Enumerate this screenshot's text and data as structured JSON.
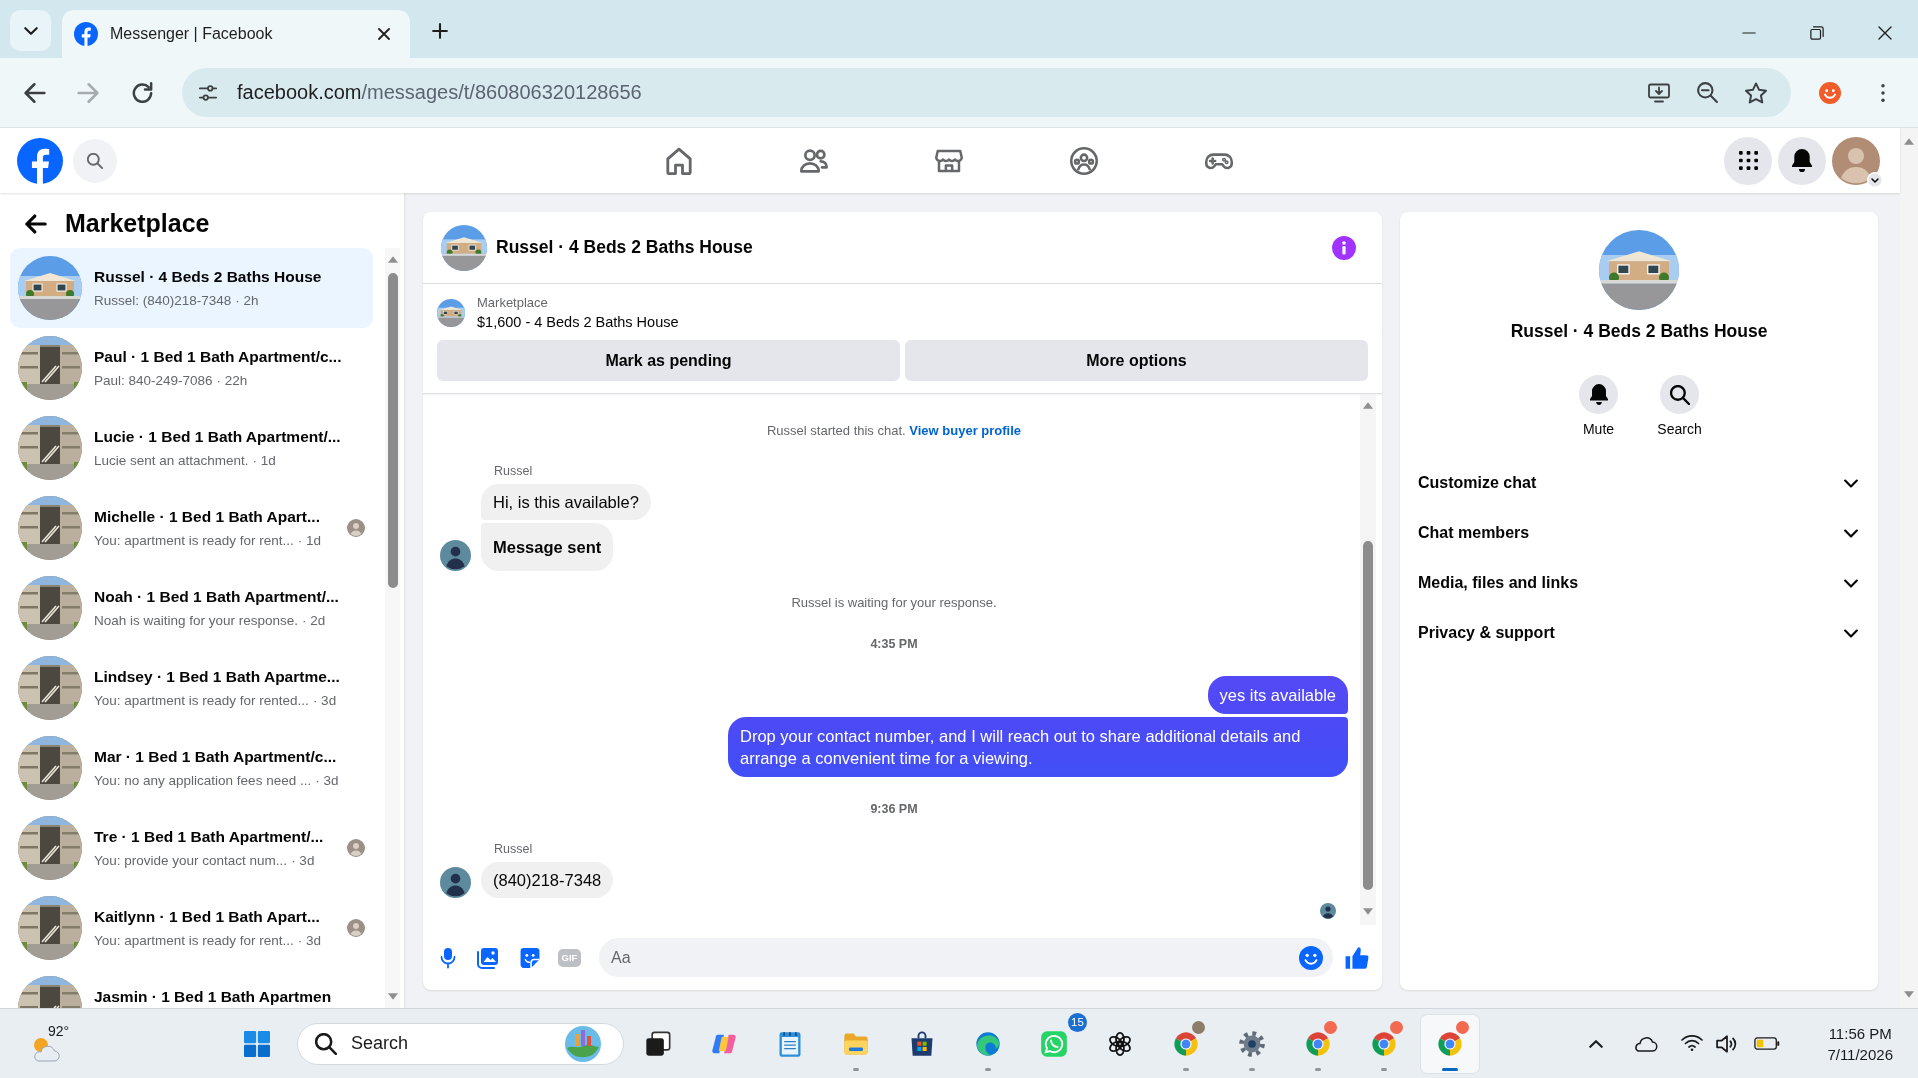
{
  "browser": {
    "tabs": [
      {
        "title": "Messenger | Facebook",
        "selected": true
      }
    ],
    "address": {
      "host": "facebook.com",
      "path": "/messages/t/860806320128656"
    }
  },
  "header": {
    "nav": [
      {
        "kind": "home"
      },
      {
        "kind": "friends"
      },
      {
        "kind": "marketplace"
      },
      {
        "kind": "groups"
      },
      {
        "kind": "gaming"
      }
    ]
  },
  "sidebar": {
    "title": "Marketplace",
    "conversations": [
      {
        "kind": "house",
        "title": "Russel · 4 Beds 2 Baths House",
        "preview": "Russel: (840)218-7348",
        "time": "· 2h",
        "seen": false,
        "selected": true
      },
      {
        "kind": "apartment",
        "title": "Paul · 1 Bed 1 Bath Apartment/c...",
        "preview": "Paul: 840-249-7086",
        "time": "· 22h",
        "seen": false,
        "selected": false
      },
      {
        "kind": "apartment",
        "title": "Lucie · 1 Bed 1 Bath Apartment/...",
        "preview": "Lucie sent an attachment.",
        "time": "· 1d",
        "seen": false,
        "selected": false
      },
      {
        "kind": "apartment",
        "title": "Michelle · 1 Bed 1 Bath Apart...",
        "preview": "You: apartment is ready for rent...",
        "time": "· 1d",
        "seen": true,
        "selected": false
      },
      {
        "kind": "apartment",
        "title": "Noah · 1 Bed 1 Bath Apartment/...",
        "preview": "Noah is waiting for your response.",
        "time": "· 2d",
        "seen": false,
        "selected": false
      },
      {
        "kind": "apartment",
        "title": "Lindsey · 1 Bed 1 Bath Apartme...",
        "preview": "You: apartment is ready for rented...",
        "time": "· 3d",
        "seen": false,
        "selected": false
      },
      {
        "kind": "apartment",
        "title": "Mar · 1 Bed 1 Bath Apartment/c...",
        "preview": "You: no any application fees need ...",
        "time": "· 3d",
        "seen": false,
        "selected": false
      },
      {
        "kind": "apartment",
        "title": "Tre · 1 Bed 1 Bath Apartment/...",
        "preview": "You: provide your contact num...",
        "time": "· 3d",
        "seen": true,
        "selected": false
      },
      {
        "kind": "apartment",
        "title": "Kaitlynn · 1 Bed 1 Bath Apart...",
        "preview": "You: apartment is ready for rent...",
        "time": "· 3d",
        "seen": true,
        "selected": false
      },
      {
        "kind": "apartment",
        "title": "Jasmin · 1 Bed 1 Bath Apartmen",
        "seen": false,
        "selected": false
      }
    ]
  },
  "chat": {
    "title": "Russel · 4 Beds 2 Baths House",
    "listing": {
      "source": "Marketplace",
      "title": "$1,600 - 4 Beds 2 Baths House"
    },
    "actions": [
      "Mark as pending",
      "More options"
    ],
    "messages": [
      {
        "kind": "notice",
        "text": "Russel started this chat.",
        "link": "View buyer profile"
      },
      {
        "kind": "incoming",
        "sender": "Russel",
        "bubbles": [
          {
            "text": "Hi, is this available?",
            "bold": false
          },
          {
            "text": "Message sent",
            "bold": true
          }
        ]
      },
      {
        "kind": "notice",
        "text": "Russel is waiting for your response."
      },
      {
        "kind": "timestamp",
        "text": "4:35 PM"
      },
      {
        "kind": "outgoing",
        "bubbles": [
          {
            "text": "yes its available"
          },
          {
            "text": "Drop your contact number, and I will reach out to share additional details and arrange a convenient time for a viewing."
          }
        ]
      },
      {
        "kind": "timestamp",
        "text": "9:36 PM"
      },
      {
        "kind": "incoming",
        "sender": "Russel",
        "bubbles": [
          {
            "text": "(840)218-7348",
            "bold": false
          }
        ]
      }
    ],
    "seen": true,
    "composer": {
      "gif_label": "GIF",
      "placeholder": "Aa"
    }
  },
  "details": {
    "title": "Russel · 4 Beds 2 Baths House",
    "actions": [
      {
        "kind": "mute",
        "label": "Mute"
      },
      {
        "kind": "search",
        "label": "Search"
      }
    ],
    "sections": [
      {
        "label": "Customize chat",
        "expanded": false
      },
      {
        "label": "Chat members",
        "expanded": false
      },
      {
        "label": "Media, files and links",
        "expanded": false
      },
      {
        "label": "Privacy & support",
        "expanded": false
      }
    ]
  },
  "taskbar": {
    "weather": {
      "temp": "92°"
    },
    "search": {
      "label": "Search"
    },
    "apps": [
      {
        "kind": "task-view",
        "running": false,
        "selected": false
      },
      {
        "kind": "copilot",
        "running": false,
        "selected": false
      },
      {
        "kind": "notepad",
        "running": false,
        "selected": false
      },
      {
        "kind": "files",
        "running": true,
        "selected": false
      },
      {
        "kind": "store",
        "running": false,
        "selected": false
      },
      {
        "kind": "edge",
        "running": true,
        "selected": false
      },
      {
        "kind": "whatsapp",
        "running": false,
        "selected": false,
        "badge": "15"
      },
      {
        "kind": "chatgpt",
        "running": false,
        "selected": false
      },
      {
        "kind": "chrome",
        "running": true,
        "selected": false,
        "color": "#8c7d6b"
      },
      {
        "kind": "settings",
        "running": true,
        "selected": false
      },
      {
        "kind": "chrome",
        "running": true,
        "selected": false,
        "color": "#f26a4f"
      },
      {
        "kind": "chrome",
        "running": true,
        "selected": false,
        "color": "#f26a4f"
      },
      {
        "kind": "chrome",
        "running": true,
        "selected": true,
        "color": "#f26a4f"
      }
    ],
    "clock": {
      "time": "11:56 PM",
      "date": "7/11/2026"
    }
  }
}
